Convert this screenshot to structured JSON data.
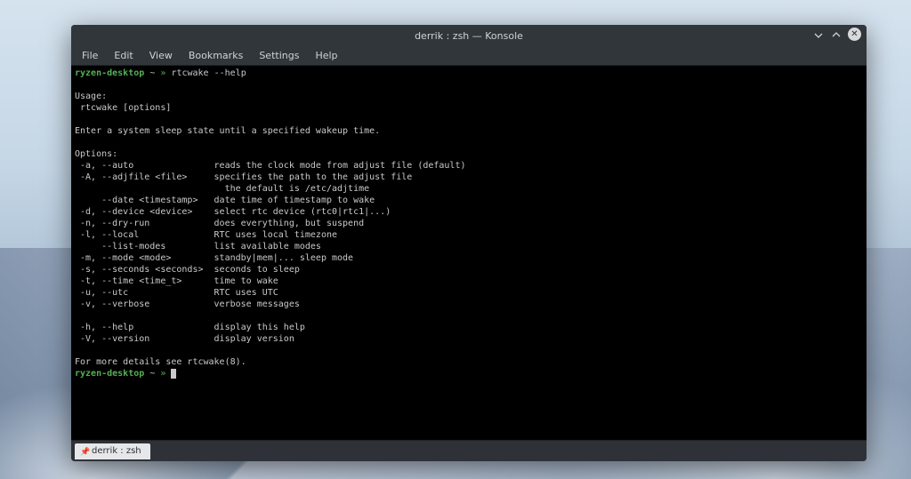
{
  "window": {
    "title": "derrik : zsh — Konsole"
  },
  "menu": {
    "file": "File",
    "edit": "Edit",
    "view": "View",
    "bookmarks": "Bookmarks",
    "settings": "Settings",
    "help": "Help"
  },
  "prompt": {
    "host": "ryzen-desktop",
    "cwd": "~",
    "arrow": "»",
    "command": "rtcwake --help"
  },
  "output": {
    "l01": "",
    "l02": "Usage:",
    "l03": " rtcwake [options]",
    "l04": "",
    "l05": "Enter a system sleep state until a specified wakeup time.",
    "l06": "",
    "l07": "Options:",
    "l08": " -a, --auto               reads the clock mode from adjust file (default)",
    "l09": " -A, --adjfile <file>     specifies the path to the adjust file",
    "l10": "                            the default is /etc/adjtime",
    "l11": "     --date <timestamp>   date time of timestamp to wake",
    "l12": " -d, --device <device>    select rtc device (rtc0|rtc1|...)",
    "l13": " -n, --dry-run            does everything, but suspend",
    "l14": " -l, --local              RTC uses local timezone",
    "l15": "     --list-modes         list available modes",
    "l16": " -m, --mode <mode>        standby|mem|... sleep mode",
    "l17": " -s, --seconds <seconds>  seconds to sleep",
    "l18": " -t, --time <time_t>      time to wake",
    "l19": " -u, --utc                RTC uses UTC",
    "l20": " -v, --verbose            verbose messages",
    "l21": "",
    "l22": " -h, --help               display this help",
    "l23": " -V, --version            display version",
    "l24": "",
    "l25": "For more details see rtcwake(8)."
  },
  "tab": {
    "label": "derrik : zsh"
  }
}
